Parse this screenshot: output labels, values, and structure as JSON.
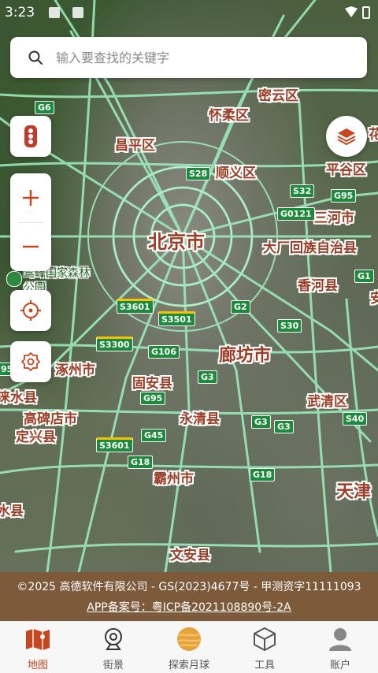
{
  "status_bar": {
    "time": "3:23"
  },
  "search": {
    "placeholder": "输入要查找的关键字"
  },
  "map": {
    "labels": {
      "miyun": "密云区",
      "huairou": "怀柔区",
      "changping": "昌平区",
      "shunyi": "顺义区",
      "pinggu": "平谷区",
      "sanhe": "三河市",
      "beijing": "北京市",
      "dachang": "大厂回族自治县",
      "xianghe": "香河县",
      "langfang": "廊坊市",
      "zhuozhou": "涿州市",
      "guan": "固安县",
      "laishui": "涞水县",
      "gaobeidian": "高碑店市",
      "dingxing": "定兴县",
      "yongqing": "永清县",
      "wuqing": "武清区",
      "bazhou": "霸州市",
      "tianjin": "天津",
      "wenan": "文安县",
      "hua": "花",
      "an": "安",
      "shui": "水县",
      "park": "鹫峰国家森林公园"
    },
    "shields": {
      "g6": "G6",
      "s28": "S28",
      "s32": "S32",
      "g95a": "G95",
      "g0121": "G0121",
      "g1": "G1",
      "s3601a": "S3601",
      "g2": "G2",
      "s3501": "S3501",
      "s30": "S30",
      "s3300": "S3300",
      "g106": "G106",
      "g3a": "G3",
      "g95b": "G95",
      "g45": "G45",
      "s3601b": "S3601",
      "g18a": "G18",
      "g18b": "G18",
      "g3b": "G3",
      "g3c": "G3",
      "s40": "S40",
      "g95c": "95"
    }
  },
  "footer": {
    "copyright": "©2025 高德软件有限公司 - GS(2023)4677号 - 甲测资字11111093",
    "icp": "APP备案号：粤ICP备2021108890号-2A"
  },
  "tabs": [
    {
      "label": "地图"
    },
    {
      "label": "街景"
    },
    {
      "label": "探索月球"
    },
    {
      "label": "工具"
    },
    {
      "label": "账户"
    }
  ],
  "colors": {
    "accent": "#c7461e",
    "road": "#7ee8a8",
    "footer_bg": "#7d5a3a"
  }
}
